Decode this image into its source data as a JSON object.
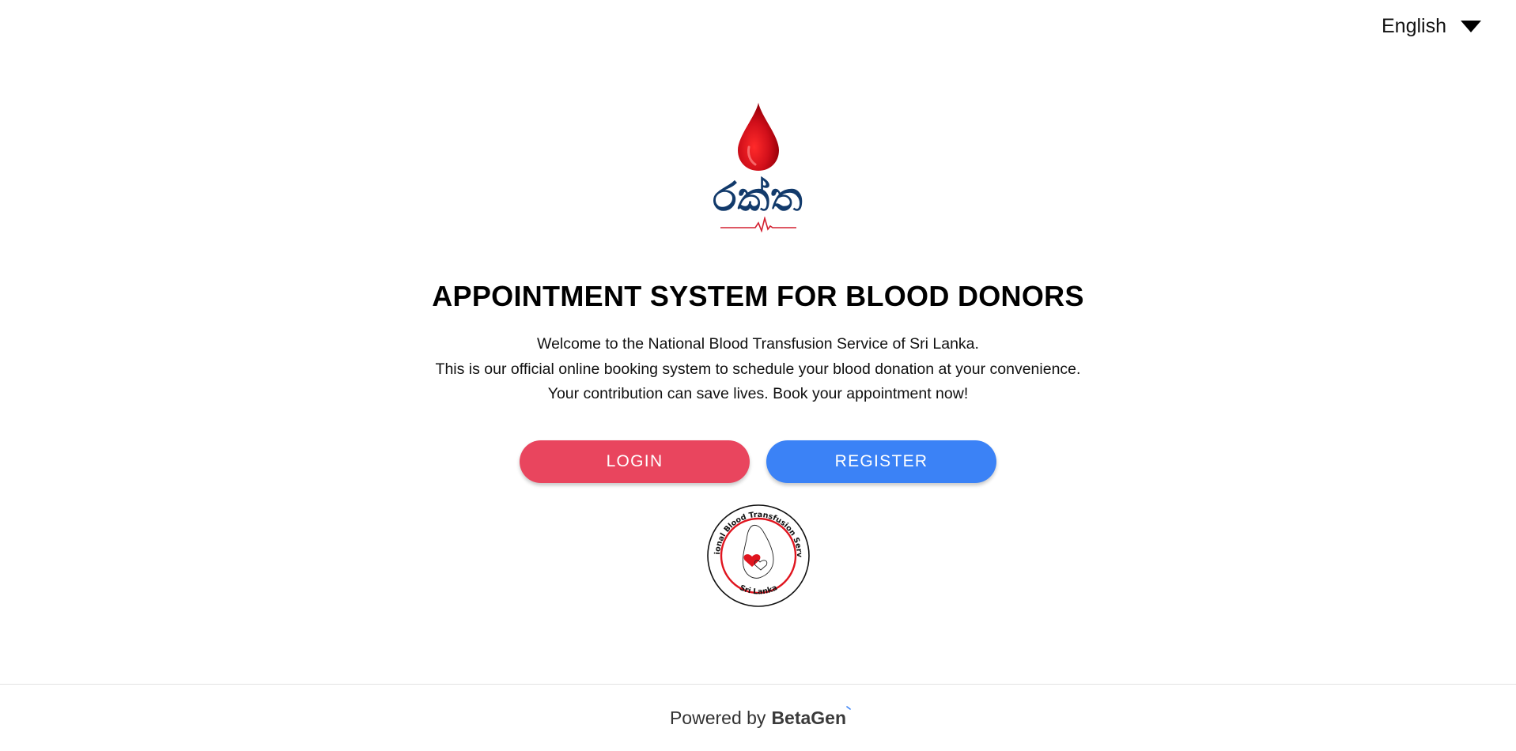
{
  "language_selector": {
    "value": "English"
  },
  "logo": {
    "text": "රක්ත"
  },
  "heading": {
    "title": "APPOINTMENT SYSTEM FOR BLOOD DONORS"
  },
  "intro": {
    "lines": [
      "Welcome to the National Blood Transfusion Service of Sri Lanka.",
      "This is our official online booking system to schedule your blood donation at your convenience.",
      "Your contribution can save lives. Book your appointment now!"
    ]
  },
  "actions": {
    "login_label": "LOGIN",
    "register_label": "REGISTER"
  },
  "seal": {
    "top_text": "National Blood Transfusion Service",
    "bottom_text": "Sri Lanka"
  },
  "footer": {
    "prefix": "Powered by",
    "brand": "BetaGen"
  },
  "colors": {
    "login_button": "#e9455e",
    "register_button": "#3b82f6",
    "logo_text": "#123a6b",
    "blood_red": "#d10f1a"
  },
  "icons": {
    "language_dropdown": "caret-down-icon",
    "logo_drop": "blood-drop-icon",
    "logo_pulse": "heartbeat-line-icon",
    "seal_heart": "heart-icon"
  }
}
